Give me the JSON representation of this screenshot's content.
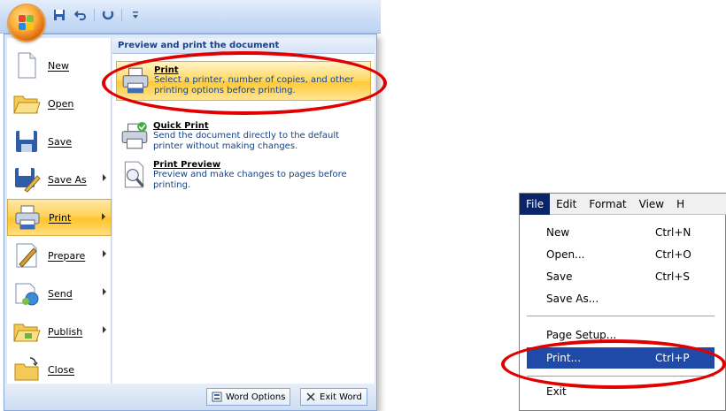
{
  "office": {
    "qat": [
      "save-icon",
      "undo-icon",
      "redo-icon",
      "customize-icon"
    ],
    "left_menu": [
      {
        "label": "New",
        "icon": "new-document-icon",
        "arrow": false
      },
      {
        "label": "Open",
        "icon": "open-folder-icon",
        "arrow": false
      },
      {
        "label": "Save",
        "icon": "save-icon",
        "arrow": false
      },
      {
        "label": "Save As",
        "icon": "save-as-icon",
        "arrow": true
      },
      {
        "label": "Print",
        "icon": "printer-icon",
        "arrow": true,
        "active": true
      },
      {
        "label": "Prepare",
        "icon": "prepare-icon",
        "arrow": true
      },
      {
        "label": "Send",
        "icon": "send-icon",
        "arrow": true
      },
      {
        "label": "Publish",
        "icon": "publish-icon",
        "arrow": true
      },
      {
        "label": "Close",
        "icon": "close-folder-icon",
        "arrow": false
      }
    ],
    "panel_header": "Preview and print the document",
    "panel_items": [
      {
        "title": "Print",
        "desc": "Select a printer, number of copies, and other printing options before printing.",
        "icon": "printer-icon"
      },
      {
        "title": "Quick Print",
        "desc": "Send the document directly to the default printer without making changes.",
        "icon": "quick-print-icon"
      },
      {
        "title": "Print Preview",
        "desc": "Preview and make changes to pages before printing.",
        "icon": "print-preview-icon"
      }
    ],
    "buttons": {
      "word_options": "Word Options",
      "exit_word": "Exit Word"
    }
  },
  "classic": {
    "menubar": [
      "File",
      "Edit",
      "Format",
      "View",
      "H"
    ],
    "items": [
      {
        "label": "New",
        "shortcut": "Ctrl+N"
      },
      {
        "label": "Open...",
        "shortcut": "Ctrl+O"
      },
      {
        "label": "Save",
        "shortcut": "Ctrl+S"
      },
      {
        "label": "Save As...",
        "shortcut": ""
      },
      {
        "label": "Page Setup...",
        "shortcut": ""
      },
      {
        "label": "Print...",
        "shortcut": "Ctrl+P"
      },
      {
        "label": "Exit",
        "shortcut": ""
      }
    ]
  },
  "colors": {
    "highlight_ring": "#e00000",
    "active_gradient": "#ffd35a",
    "menu_selection": "#1f4aa8"
  }
}
